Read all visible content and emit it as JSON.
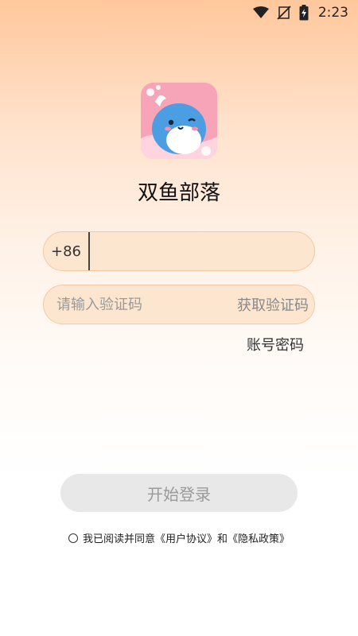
{
  "status_bar": {
    "time": "2:23"
  },
  "app": {
    "name": "双鱼部落"
  },
  "phone": {
    "country_code": "+86",
    "value": ""
  },
  "code": {
    "placeholder": "请输入验证码",
    "get_code_label": "获取验证码"
  },
  "switch_login": {
    "label": "账号密码"
  },
  "login_button": {
    "label": "开始登录"
  },
  "agreement": {
    "text": "我已阅读并同意《用户协议》和《隐私政策》"
  },
  "colors": {
    "field_bg": "#fde6d0",
    "field_border": "#f4c9a3",
    "button_bg": "#e8e8e8",
    "button_text": "#9a9a9a",
    "logo_bg": "#f7a3b8",
    "mascot": "#4c9ee3"
  }
}
